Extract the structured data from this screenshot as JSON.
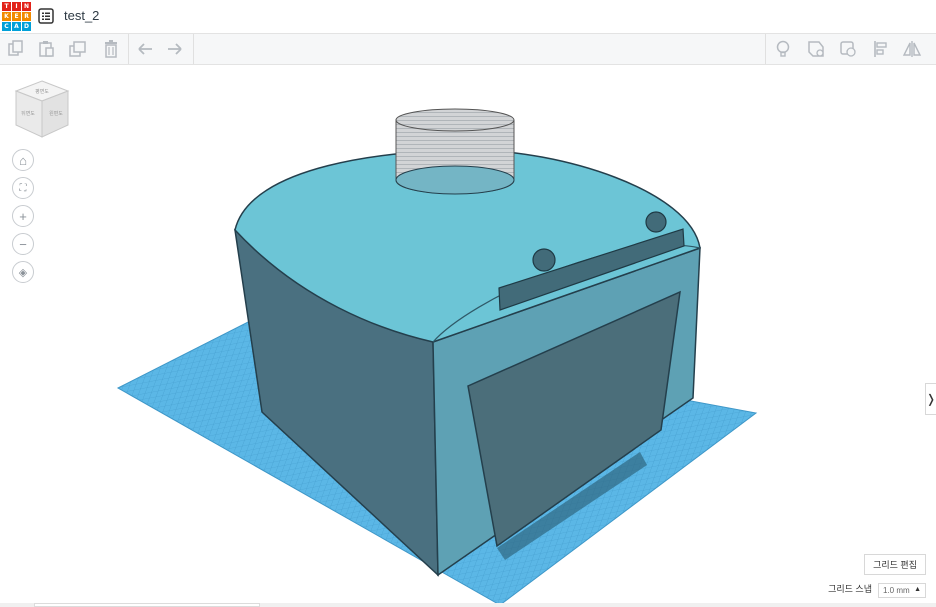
{
  "app": {
    "logo_letters": [
      "T",
      "I",
      "N",
      "K",
      "E",
      "R",
      "C",
      "A",
      "D"
    ],
    "logo_colors": [
      "#e2231a",
      "#e2231a",
      "#e2231a",
      "#f18a00",
      "#f18a00",
      "#f18a00",
      "#00a0d8",
      "#00a0d8",
      "#00a0d8"
    ],
    "design_title": "test_2"
  },
  "toolbar": {
    "left_icons": [
      "copy-icon",
      "paste-icon",
      "duplicate-icon",
      "delete-icon",
      "undo-icon",
      "redo-icon"
    ],
    "right_icons": [
      "light-bulb-icon",
      "shape-icon",
      "hole-icon",
      "align-icon",
      "mirror-icon"
    ]
  },
  "viewcube": {
    "top_label": "평면도",
    "left_label": "뒤면도",
    "right_label": "왼편도"
  },
  "nav": {
    "home": "⌂",
    "fit": "⛶",
    "zoom_in": "+",
    "zoom_out": "−",
    "perspective": "◈"
  },
  "panel": {
    "toggle": "❭"
  },
  "footer": {
    "grid_edit_label": "그리드 편집",
    "snap_label": "그리드 스냅",
    "snap_value": "1.0 mm",
    "snap_arrow": "▲"
  },
  "colors": {
    "body": "#4a7080",
    "top": "#6cc5d6",
    "front": "#5ea1b4",
    "window": "#4b6e7a",
    "grid": "#5bb7e6",
    "hole": "#c8c8c8"
  }
}
